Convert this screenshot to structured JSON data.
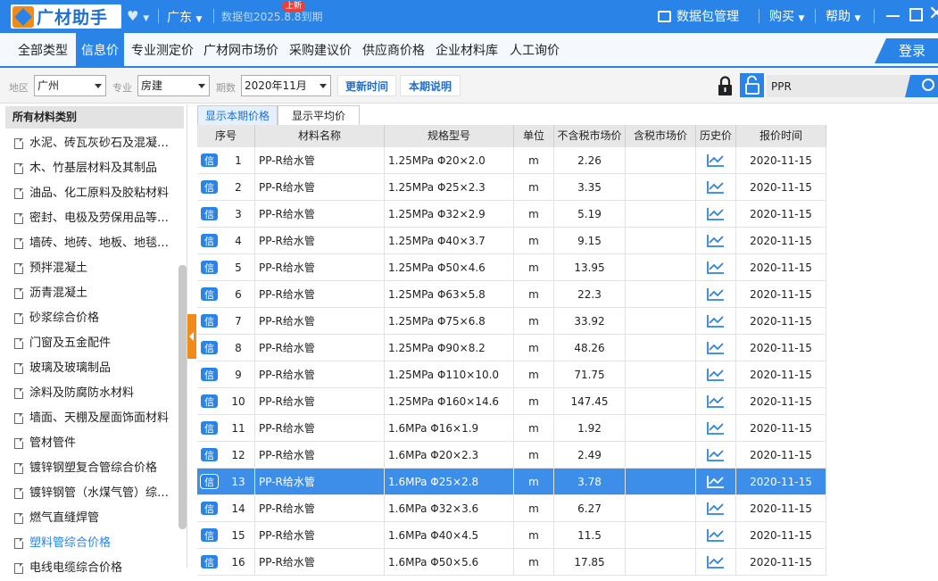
{
  "titlebar": {
    "logo_text": "广材助手",
    "region": "广东",
    "data_package_expiry": "数据包2025.8.8到期",
    "data_package_manage": "数据包管理",
    "buy": "购买",
    "help": "帮助",
    "accent_color": "#2a84e8"
  },
  "nav": {
    "tabs": [
      {
        "label": "全部类型"
      },
      {
        "label": "信息价",
        "active": true
      },
      {
        "label": "专业测定价"
      },
      {
        "label": "广材网市场价"
      },
      {
        "label": "采购建议价",
        "badge": "上新"
      },
      {
        "label": "供应商价格"
      },
      {
        "label": "企业材料库"
      },
      {
        "label": "人工询价"
      }
    ],
    "login": "登录"
  },
  "filters": {
    "area_label": "地区",
    "area_value": "广州",
    "major_label": "专业",
    "major_value": "房建",
    "period_label": "期数",
    "period_value": "2020年11月",
    "update_time_button": "更新时间",
    "period_note_button": "本期说明",
    "search_value": "PPR"
  },
  "sidebar": {
    "header": "所有材料类别",
    "items": [
      "水泥、砖瓦灰砂石及混凝…",
      "木、竹基层材料及其制品",
      "油品、化工原料及胶粘材料",
      "密封、电极及劳保用品等…",
      "墙砖、地砖、地板、地毯…",
      "预拌混凝土",
      "沥青混凝土",
      "砂浆综合价格",
      "门窗及五金配件",
      "玻璃及玻璃制品",
      "涂料及防腐防水材料",
      "墙面、天棚及屋面饰面材料",
      "管材管件",
      "镀锌钢塑复合管综合价格",
      "镀锌钢管（水煤气管）综…",
      "燃气直缝焊管",
      "塑料管综合价格",
      "电线电缆综合价格"
    ],
    "highlighted_index": 16
  },
  "price_tabs": [
    "显示本期价格",
    "显示平均价"
  ],
  "table": {
    "columns": [
      "序号",
      "材料名称",
      "规格型号",
      "单位",
      "不含税市场价",
      "含税市场价",
      "历史价",
      "报价时间"
    ],
    "tag": "信",
    "selected_row": 12,
    "rows": [
      {
        "no": "1",
        "name": "PP-R给水管",
        "spec": "1.25MPa Φ20×2.0",
        "unit": "m",
        "price": "2.26",
        "tax_price": "",
        "date": "2020-11-15"
      },
      {
        "no": "2",
        "name": "PP-R给水管",
        "spec": "1.25MPa Φ25×2.3",
        "unit": "m",
        "price": "3.35",
        "tax_price": "",
        "date": "2020-11-15"
      },
      {
        "no": "3",
        "name": "PP-R给水管",
        "spec": "1.25MPa Φ32×2.9",
        "unit": "m",
        "price": "5.19",
        "tax_price": "",
        "date": "2020-11-15"
      },
      {
        "no": "4",
        "name": "PP-R给水管",
        "spec": "1.25MPa Φ40×3.7",
        "unit": "m",
        "price": "9.15",
        "tax_price": "",
        "date": "2020-11-15"
      },
      {
        "no": "5",
        "name": "PP-R给水管",
        "spec": "1.25MPa Φ50×4.6",
        "unit": "m",
        "price": "13.95",
        "tax_price": "",
        "date": "2020-11-15"
      },
      {
        "no": "6",
        "name": "PP-R给水管",
        "spec": "1.25MPa Φ63×5.8",
        "unit": "m",
        "price": "22.3",
        "tax_price": "",
        "date": "2020-11-15"
      },
      {
        "no": "7",
        "name": "PP-R给水管",
        "spec": "1.25MPa Φ75×6.8",
        "unit": "m",
        "price": "33.92",
        "tax_price": "",
        "date": "2020-11-15"
      },
      {
        "no": "8",
        "name": "PP-R给水管",
        "spec": "1.25MPa Φ90×8.2",
        "unit": "m",
        "price": "48.26",
        "tax_price": "",
        "date": "2020-11-15"
      },
      {
        "no": "9",
        "name": "PP-R给水管",
        "spec": "1.25MPa Φ110×10.0",
        "unit": "m",
        "price": "71.75",
        "tax_price": "",
        "date": "2020-11-15"
      },
      {
        "no": "10",
        "name": "PP-R给水管",
        "spec": "1.25MPa Φ160×14.6",
        "unit": "m",
        "price": "147.45",
        "tax_price": "",
        "date": "2020-11-15"
      },
      {
        "no": "11",
        "name": "PP-R给水管",
        "spec": "1.6MPa Φ16×1.9",
        "unit": "m",
        "price": "1.92",
        "tax_price": "",
        "date": "2020-11-15"
      },
      {
        "no": "12",
        "name": "PP-R给水管",
        "spec": "1.6MPa Φ20×2.3",
        "unit": "m",
        "price": "2.49",
        "tax_price": "",
        "date": "2020-11-15"
      },
      {
        "no": "13",
        "name": "PP-R给水管",
        "spec": "1.6MPa Φ25×2.8",
        "unit": "m",
        "price": "3.78",
        "tax_price": "",
        "date": "2020-11-15"
      },
      {
        "no": "14",
        "name": "PP-R给水管",
        "spec": "1.6MPa Φ32×3.6",
        "unit": "m",
        "price": "6.27",
        "tax_price": "",
        "date": "2020-11-15"
      },
      {
        "no": "15",
        "name": "PP-R给水管",
        "spec": "1.6MPa Φ40×4.5",
        "unit": "m",
        "price": "11.5",
        "tax_price": "",
        "date": "2020-11-15"
      },
      {
        "no": "16",
        "name": "PP-R给水管",
        "spec": "1.6MPa Φ50×5.6",
        "unit": "m",
        "price": "17.85",
        "tax_price": "",
        "date": "2020-11-15"
      }
    ]
  }
}
